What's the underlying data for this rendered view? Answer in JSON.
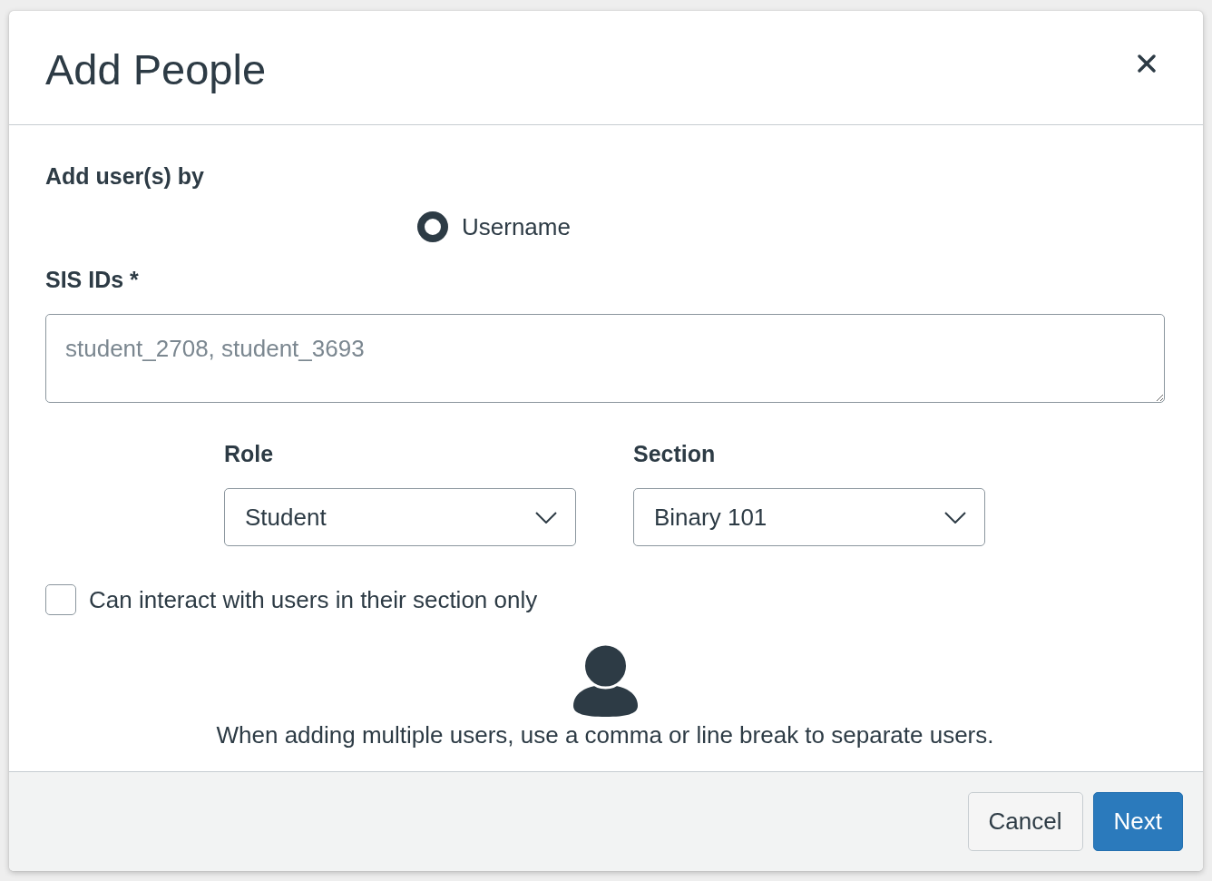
{
  "dialog": {
    "title": "Add People"
  },
  "add_by": {
    "label": "Add user(s) by",
    "options": [
      {
        "label": "Username",
        "selected": true
      }
    ]
  },
  "ids_field": {
    "label": "SIS IDs *",
    "placeholder": "student_2708, student_3693"
  },
  "selects": [
    {
      "label": "Role",
      "value": "Student"
    },
    {
      "label": "Section",
      "value": "Binary 101"
    }
  ],
  "section_limit": {
    "label": "Can interact with users in their section only",
    "checked": false
  },
  "hint": "When adding multiple users, use a comma or line break to separate users.",
  "buttons": [
    {
      "label": "Cancel",
      "kind": "secondary"
    },
    {
      "label": "Next",
      "kind": "primary"
    }
  ]
}
